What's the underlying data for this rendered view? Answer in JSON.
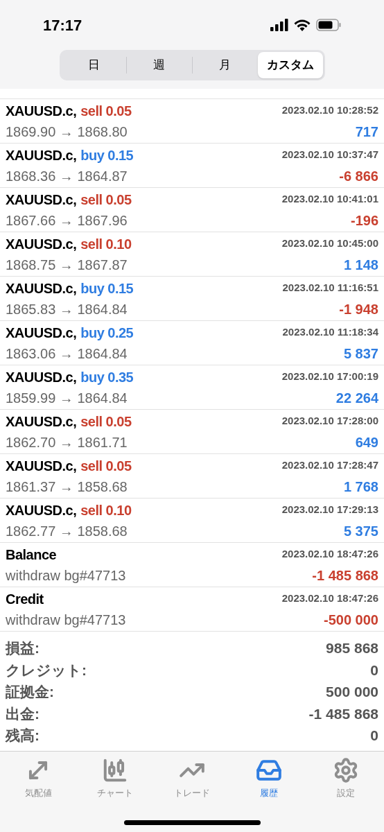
{
  "status_bar": {
    "time": "17:17"
  },
  "period_tabs": [
    {
      "label": "日",
      "selected": false
    },
    {
      "label": "週",
      "selected": false
    },
    {
      "label": "月",
      "selected": false
    },
    {
      "label": "カスタム",
      "selected": true
    }
  ],
  "deals": [
    {
      "kind": "trade",
      "symbol": "XAUUSD.c,",
      "buy": false,
      "action": "sell 0.05",
      "time": "2023.02.10 10:28:52",
      "detail": "1869.90 → 1868.80",
      "amount": "717",
      "profit": true
    },
    {
      "kind": "trade",
      "symbol": "XAUUSD.c,",
      "buy": true,
      "action": "buy 0.15",
      "time": "2023.02.10 10:37:47",
      "detail": "1868.36 → 1864.87",
      "amount": "-6 866",
      "profit": false
    },
    {
      "kind": "trade",
      "symbol": "XAUUSD.c,",
      "buy": false,
      "action": "sell 0.05",
      "time": "2023.02.10 10:41:01",
      "detail": "1867.66 → 1867.96",
      "amount": "-196",
      "profit": false
    },
    {
      "kind": "trade",
      "symbol": "XAUUSD.c,",
      "buy": false,
      "action": "sell 0.10",
      "time": "2023.02.10 10:45:00",
      "detail": "1868.75 → 1867.87",
      "amount": "1 148",
      "profit": true
    },
    {
      "kind": "trade",
      "symbol": "XAUUSD.c,",
      "buy": true,
      "action": "buy 0.15",
      "time": "2023.02.10 11:16:51",
      "detail": "1865.83 → 1864.84",
      "amount": "-1 948",
      "profit": false
    },
    {
      "kind": "trade",
      "symbol": "XAUUSD.c,",
      "buy": true,
      "action": "buy 0.25",
      "time": "2023.02.10 11:18:34",
      "detail": "1863.06 → 1864.84",
      "amount": "5 837",
      "profit": true
    },
    {
      "kind": "trade",
      "symbol": "XAUUSD.c,",
      "buy": true,
      "action": "buy 0.35",
      "time": "2023.02.10 17:00:19",
      "detail": "1859.99 → 1864.84",
      "amount": "22 264",
      "profit": true
    },
    {
      "kind": "trade",
      "symbol": "XAUUSD.c,",
      "buy": false,
      "action": "sell 0.05",
      "time": "2023.02.10 17:28:00",
      "detail": "1862.70 → 1861.71",
      "amount": "649",
      "profit": true
    },
    {
      "kind": "trade",
      "symbol": "XAUUSD.c,",
      "buy": false,
      "action": "sell 0.05",
      "time": "2023.02.10 17:28:47",
      "detail": "1861.37 → 1858.68",
      "amount": "1 768",
      "profit": true
    },
    {
      "kind": "trade",
      "symbol": "XAUUSD.c,",
      "buy": false,
      "action": "sell 0.10",
      "time": "2023.02.10 17:29:13",
      "detail": "1862.77 → 1858.68",
      "amount": "5 375",
      "profit": true
    },
    {
      "kind": "balance",
      "symbol": "Balance",
      "time": "2023.02.10 18:47:26",
      "detail": "withdraw bg#47713",
      "amount": "-1 485 868",
      "profit": false
    },
    {
      "kind": "balance",
      "symbol": "Credit",
      "time": "2023.02.10 18:47:26",
      "detail": "withdraw bg#47713",
      "amount": "-500 000",
      "profit": false
    }
  ],
  "summary": [
    {
      "label": "損益:",
      "value": "985 868"
    },
    {
      "label": "クレジット:",
      "value": "0"
    },
    {
      "label": "証拠金:",
      "value": "500 000"
    },
    {
      "label": "出金:",
      "value": "-1 485 868"
    },
    {
      "label": "残高:",
      "value": "0"
    }
  ],
  "tab_bar": [
    {
      "label": "気配値",
      "selected": false
    },
    {
      "label": "チャート",
      "selected": false
    },
    {
      "label": "トレード",
      "selected": false
    },
    {
      "label": "履歴",
      "selected": true
    },
    {
      "label": "設定",
      "selected": false
    }
  ]
}
